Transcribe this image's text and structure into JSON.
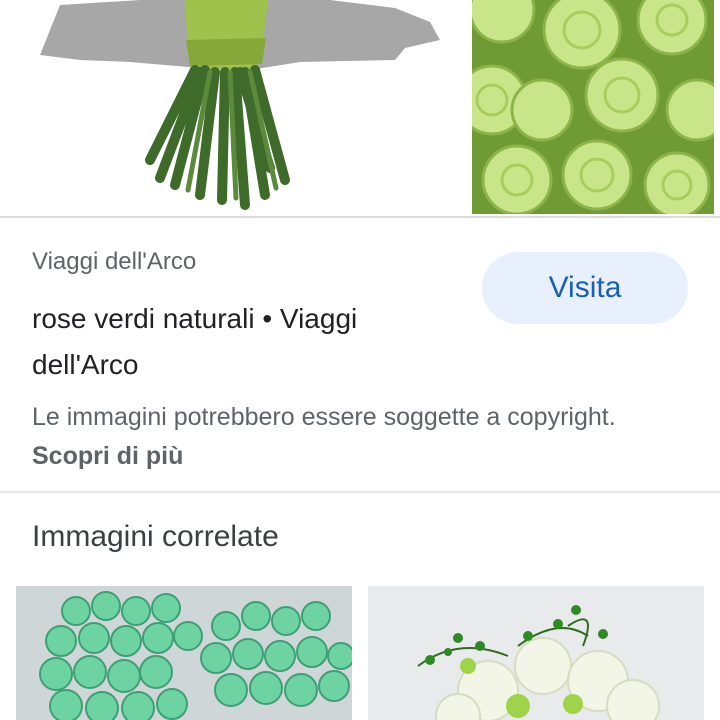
{
  "result": {
    "source": "Viaggi dell'Arco",
    "title": "rose verdi naturali • Viaggi dell'Arco",
    "visit_label": "Visita",
    "copyright_text": "Le immagini potrebbero essere soggette a copyright.",
    "learn_more_label": "Scopri di più"
  },
  "related": {
    "heading": "Immagini correlate"
  },
  "images": {
    "preview_main": "green-rose-bouquet-stems",
    "preview_side": "green-roses-closeup",
    "related_1": "mint-green-roses-bunch",
    "related_2": "white-green-floral-arrangement"
  }
}
